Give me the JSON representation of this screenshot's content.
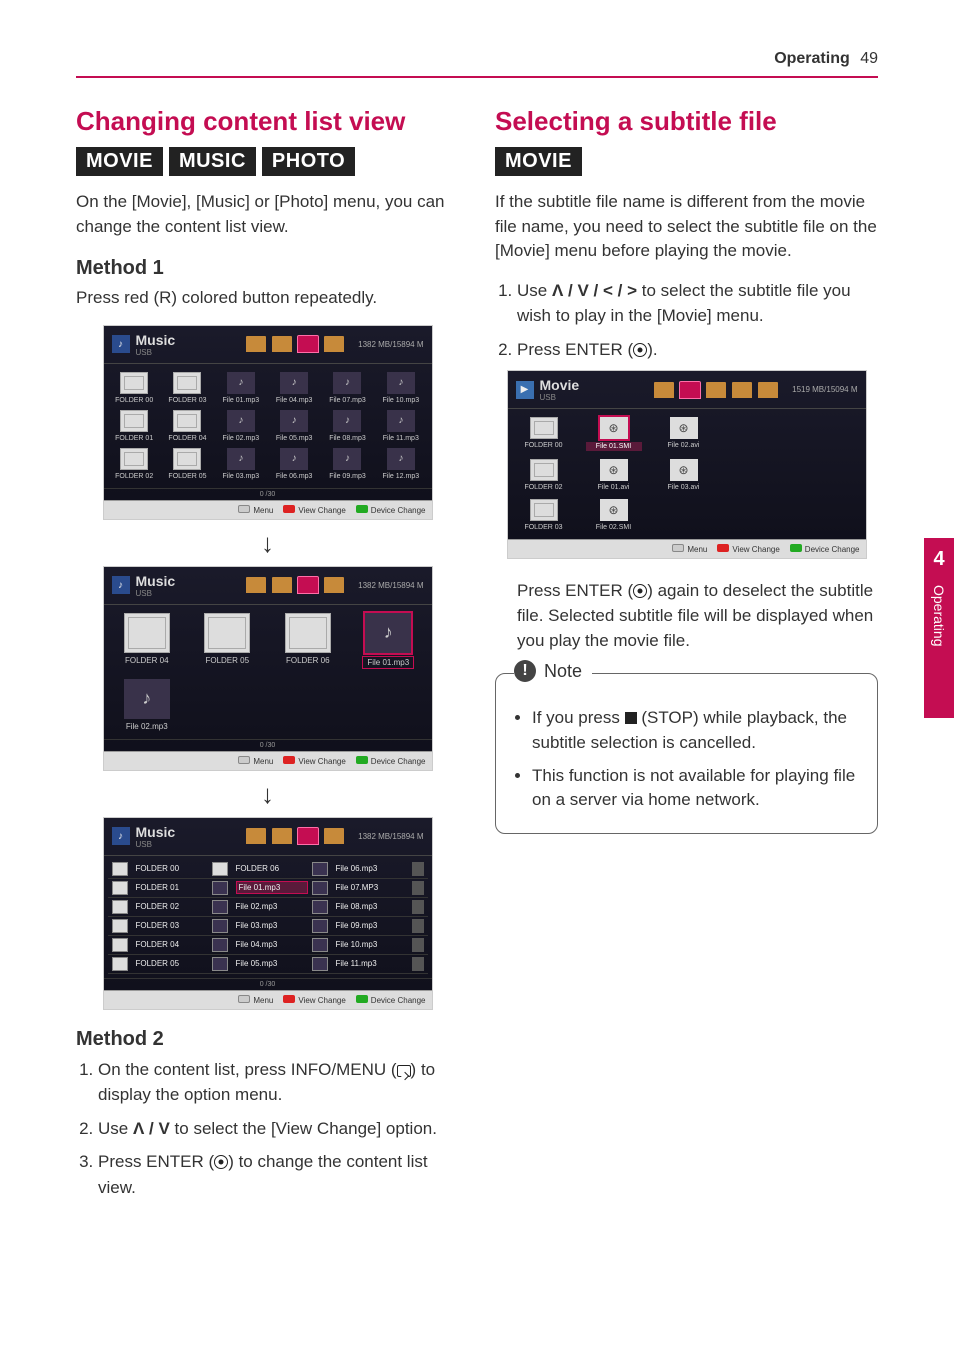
{
  "header": {
    "section": "Operating",
    "page": "49"
  },
  "side_tab": {
    "num": "4",
    "label": "Operating"
  },
  "left": {
    "title": "Changing content list view",
    "tags": [
      "MOVIE",
      "MUSIC",
      "PHOTO"
    ],
    "intro": "On the [Movie], [Music] or [Photo] menu, you can change the content list view.",
    "method1_title": "Method 1",
    "method1_body": "Press red (R) colored button repeatedly.",
    "method2_title": "Method 2",
    "method2_steps": [
      "On the content list, press INFO/MENU ",
      " to display the option menu.",
      "Use ",
      " to select the [View Change] option.",
      "Press ENTER (",
      ") to change the content list view."
    ],
    "nav_symbols_ud": "Ʌ / V",
    "screenshot_common": {
      "title": "Music",
      "sub": "USB",
      "tabs": [
        "BUDA",
        "Movie",
        "Music",
        "Photo"
      ],
      "storage": "1382 MB/15894 M",
      "counter": "0 /30",
      "footer": {
        "menu": "Menu",
        "view": "View Change",
        "device": "Device Change"
      }
    },
    "ss1_items": [
      [
        "FOLDER 00",
        "FOLDER 03",
        "File 01.mp3",
        "File 04.mp3",
        "File 07.mp3",
        "File 10.mp3"
      ],
      [
        "FOLDER 01",
        "FOLDER 04",
        "File 02.mp3",
        "File 05.mp3",
        "File 08.mp3",
        "File 11.mp3"
      ],
      [
        "FOLDER 02",
        "FOLDER 05",
        "File 03.mp3",
        "File 06.mp3",
        "File 09.mp3",
        "File 12.mp3"
      ]
    ],
    "ss1_sel_row": [
      1,
      2,
      "File 01.mp3"
    ],
    "ss2_items": [
      "FOLDER 04",
      "FOLDER 05",
      "FOLDER 06",
      "File 01.mp3",
      "File 02.mp3"
    ],
    "ss2_sel": "File 01.mp3",
    "ss3_rows": [
      [
        "FOLDER 00",
        "FOLDER 06",
        "File 06.mp3"
      ],
      [
        "FOLDER 01",
        "File 01.mp3",
        "File 07.MP3"
      ],
      [
        "FOLDER 02",
        "File 02.mp3",
        "File 08.mp3"
      ],
      [
        "FOLDER 03",
        "File 03.mp3",
        "File 09.mp3"
      ],
      [
        "FOLDER 04",
        "File 04.mp3",
        "File 10.mp3"
      ],
      [
        "FOLDER 05",
        "File 05.mp3",
        "File 11.mp3"
      ]
    ],
    "ss3_sel": "File 01.mp3"
  },
  "right": {
    "title": "Selecting a subtitle file",
    "tags": [
      "MOVIE"
    ],
    "intro": "If the subtitle file name is different from the movie file name, you need to select the subtitle file on the [Movie] menu before playing the movie.",
    "steps_prefix": [
      "Use ",
      " to select the subtitle file you wish to play in the [Movie] menu.",
      "Press ENTER (",
      ")."
    ],
    "nav_symbols_all": "Ʌ / V / < / >",
    "after_ss": "Press ENTER (",
    "after_ss_2": ") again to deselect the subtitle file. Selected subtitle file will be displayed when you play the movie file.",
    "note_label": "Note",
    "notes": [
      "If you press ",
      " (STOP) while playback, the subtitle selection is cancelled.",
      "This function is not available for playing file on a server via home network."
    ],
    "ss_movie": {
      "title": "Movie",
      "sub": "USB",
      "tabs": [
        "BUDA",
        "Movie",
        "Music",
        "Photo",
        "UF0_ALL_"
      ],
      "storage": "1519 MB/15094 M",
      "rows": [
        [
          "FOLDER 00",
          "File 01.SMI",
          "File 02.avi"
        ],
        [
          "FOLDER 02",
          "File 01.avi",
          "File 03.avi"
        ],
        [
          "FOLDER 03",
          "File 02.SMI",
          ""
        ]
      ],
      "sel": "File 01.SMI",
      "footer": {
        "menu": "Menu",
        "view": "View Change",
        "device": "Device Change"
      }
    }
  }
}
